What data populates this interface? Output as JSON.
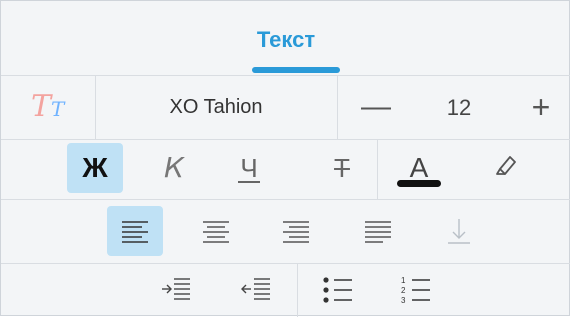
{
  "tab": {
    "title": "Текст"
  },
  "font": {
    "icon": "text-style-icon",
    "name": "XO Tahion",
    "decrease_label": "—",
    "size": "12",
    "increase_label": "+"
  },
  "styles": {
    "bold": "Ж",
    "italic": "К",
    "underline": "Ч",
    "strikethrough": "Т",
    "text_color": "А",
    "text_color_value": "#111111"
  },
  "colors": {
    "accent": "#2a9ad8",
    "active_bg": "#bfe1f5"
  },
  "alignment": {
    "selected": "left",
    "icons": [
      "align-left-icon",
      "align-center-icon",
      "align-right-icon",
      "align-justify-icon",
      "align-bottom-icon"
    ]
  },
  "lists": {
    "icons": [
      "indent-increase-icon",
      "indent-decrease-icon",
      "bulleted-list-icon",
      "numbered-list-icon"
    ],
    "number_labels": [
      "1",
      "2",
      "3"
    ]
  }
}
